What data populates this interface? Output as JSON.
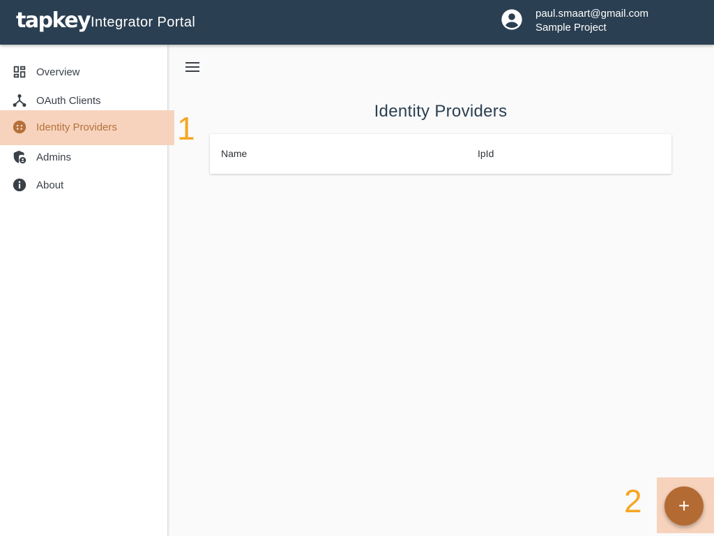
{
  "header": {
    "logo": "tapkey",
    "title": "Integrator Portal",
    "account_email": "paul.smaart@gmail.com",
    "account_project": "Sample Project"
  },
  "sidebar": {
    "items": [
      {
        "label": "Overview",
        "icon": "dashboard-icon"
      },
      {
        "label": "OAuth Clients",
        "icon": "network-icon"
      },
      {
        "label": "Identity Providers",
        "icon": "face-icon",
        "active": true
      },
      {
        "label": "Admins",
        "icon": "admin-shield-icon"
      },
      {
        "label": "About",
        "icon": "info-icon"
      }
    ]
  },
  "callouts": {
    "one": "1",
    "two": "2"
  },
  "main": {
    "title": "Identity Providers",
    "table": {
      "columns": [
        "Name",
        "IpId"
      ],
      "rows": []
    },
    "add_button": "+"
  },
  "colors": {
    "header_bg": "#2b3f52",
    "accent": "#b36b33",
    "highlight": "#f7d3bd",
    "callout": "#f6a623"
  }
}
